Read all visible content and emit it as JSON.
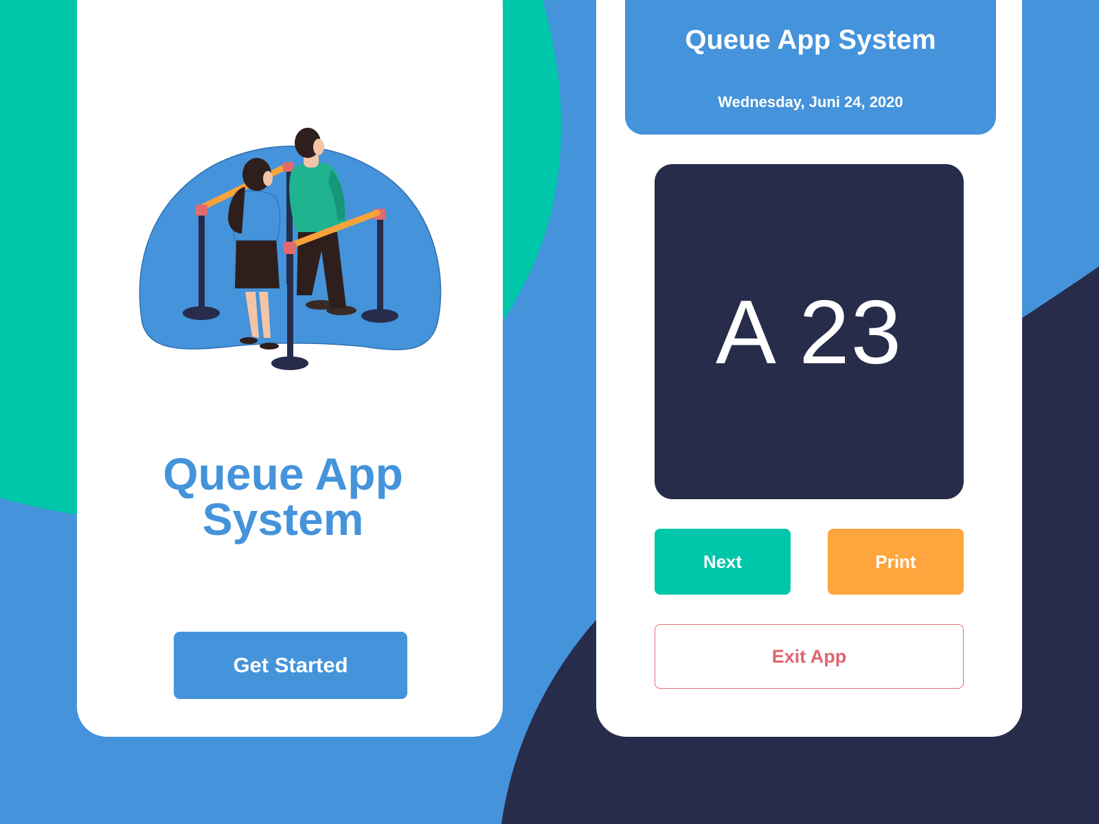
{
  "colors": {
    "background_blue": "#4493DB",
    "teal": "#00C6AA",
    "navy": "#262C4A",
    "orange": "#FFA53D",
    "exit_red": "#DD6670",
    "white": "#FFFFFF"
  },
  "welcome_screen": {
    "illustration": "people-queue-illustration",
    "title": "Queue App System",
    "get_started_label": "Get Started"
  },
  "queue_screen": {
    "header": {
      "title": "Queue App System",
      "date": "Wednesday, Juni 24, 2020"
    },
    "current_number": "A 23",
    "next_label": "Next",
    "print_label": "Print",
    "exit_label": "Exit App"
  }
}
